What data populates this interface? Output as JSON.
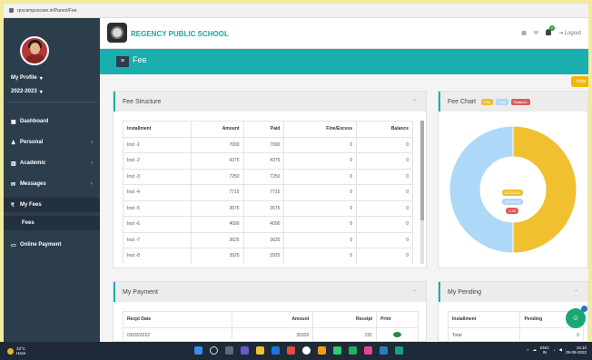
{
  "browser": {
    "url": "rpscampuscare.in/Parent/Fee"
  },
  "sidebar": {
    "profile_label": "My Profile",
    "year_label": "2022-2023",
    "items": [
      {
        "label": "Dashboard",
        "icon": "dashboard-icon"
      },
      {
        "label": "Personal",
        "icon": "user-icon"
      },
      {
        "label": "Academic",
        "icon": "bank-icon"
      },
      {
        "label": "Messages",
        "icon": "envelope-icon"
      },
      {
        "label": "My Fees",
        "icon": "rupee-icon"
      },
      {
        "label": "Fees",
        "icon": ""
      },
      {
        "label": "Online Payment",
        "icon": "card-icon"
      }
    ]
  },
  "header": {
    "school_name": "REGENCY PUBLIC SCHOOL",
    "logout_label": "Logout",
    "notification_count": "0"
  },
  "page": {
    "title": "Fee",
    "help_label": "Help"
  },
  "fee_structure": {
    "title": "Fee Structure",
    "columns": [
      "Installment",
      "Amount",
      "Paid",
      "Fine/Excess",
      "Balance"
    ],
    "rows": [
      [
        "Inst -1",
        "7000",
        "7000",
        "0",
        "0"
      ],
      [
        "Inst -2",
        "4375",
        "4375",
        "0",
        "0"
      ],
      [
        "Inst -3",
        "7250",
        "7250",
        "0",
        "0"
      ],
      [
        "Inst -4",
        "7715",
        "7715",
        "0",
        "0"
      ],
      [
        "Inst -5",
        "3675",
        "3675",
        "0",
        "0"
      ],
      [
        "Inst -6",
        "4090",
        "4090",
        "0",
        "0"
      ],
      [
        "Inst -7",
        "3625",
        "3625",
        "0",
        "0"
      ],
      [
        "Inst -8",
        "3925",
        "3925",
        "0",
        "0"
      ]
    ]
  },
  "fee_chart": {
    "title": "Fee Chart",
    "legend": [
      "Fee",
      "Paid",
      "Balance"
    ],
    "colors": {
      "fee": "#f0c030",
      "paid": "#aed8f7",
      "balance": "#e05a5a"
    },
    "labels": [
      "42725.00",
      "42725.00",
      "0.00"
    ]
  },
  "chart_data": {
    "type": "pie",
    "categories": [
      "Fee",
      "Paid",
      "Balance"
    ],
    "values": [
      42725,
      42725,
      0
    ]
  },
  "my_payment": {
    "title": "My Payment",
    "columns": [
      "Recpt Date",
      "Amount",
      "Receipt",
      "Print"
    ],
    "rows": [
      [
        "03/03/2022",
        "39320",
        "231",
        ""
      ]
    ]
  },
  "my_pending": {
    "title": "My Pending",
    "columns": [
      "Installment",
      "Pending"
    ],
    "rows": [
      [
        "Total",
        "0"
      ]
    ]
  },
  "taskbar": {
    "temperature": "33°C",
    "weather": "Haze",
    "lang": "ENG",
    "region": "IN",
    "time": "16:10",
    "date": "29-09-2022"
  }
}
